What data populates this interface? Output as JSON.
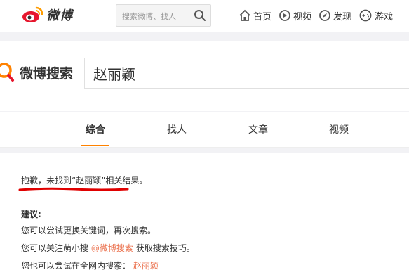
{
  "header": {
    "logo_text": "微博",
    "search_placeholder": "搜索微博、找人",
    "nav": [
      {
        "label": "首页",
        "icon": "home-icon"
      },
      {
        "label": "视频",
        "icon": "video-icon"
      },
      {
        "label": "发现",
        "icon": "compass-icon"
      },
      {
        "label": "游戏",
        "icon": "gamepad-icon"
      }
    ]
  },
  "search": {
    "brand": "微博搜索",
    "query": "赵丽颖"
  },
  "tabs": [
    {
      "label": "综合",
      "active": true
    },
    {
      "label": "找人"
    },
    {
      "label": "文章"
    },
    {
      "label": "视频"
    }
  ],
  "results": {
    "sorry_text": "抱歉，未找到“赵丽颖”相关结果。",
    "suggest_title": "建议:",
    "suggest_1": "您可以尝试更换关键词，再次搜索。",
    "suggest_2_prefix": "您可以关注萌小搜",
    "suggest_2_link": "@微博搜索",
    "suggest_2_suffix": "获取搜索技巧。",
    "suggest_3_prefix": "您也可以尝试在全网内搜索：",
    "suggest_3_link": "赵丽颖"
  },
  "colors": {
    "accent": "#ff8200",
    "link": "#eb7350",
    "annotation_red": "#e00000"
  }
}
